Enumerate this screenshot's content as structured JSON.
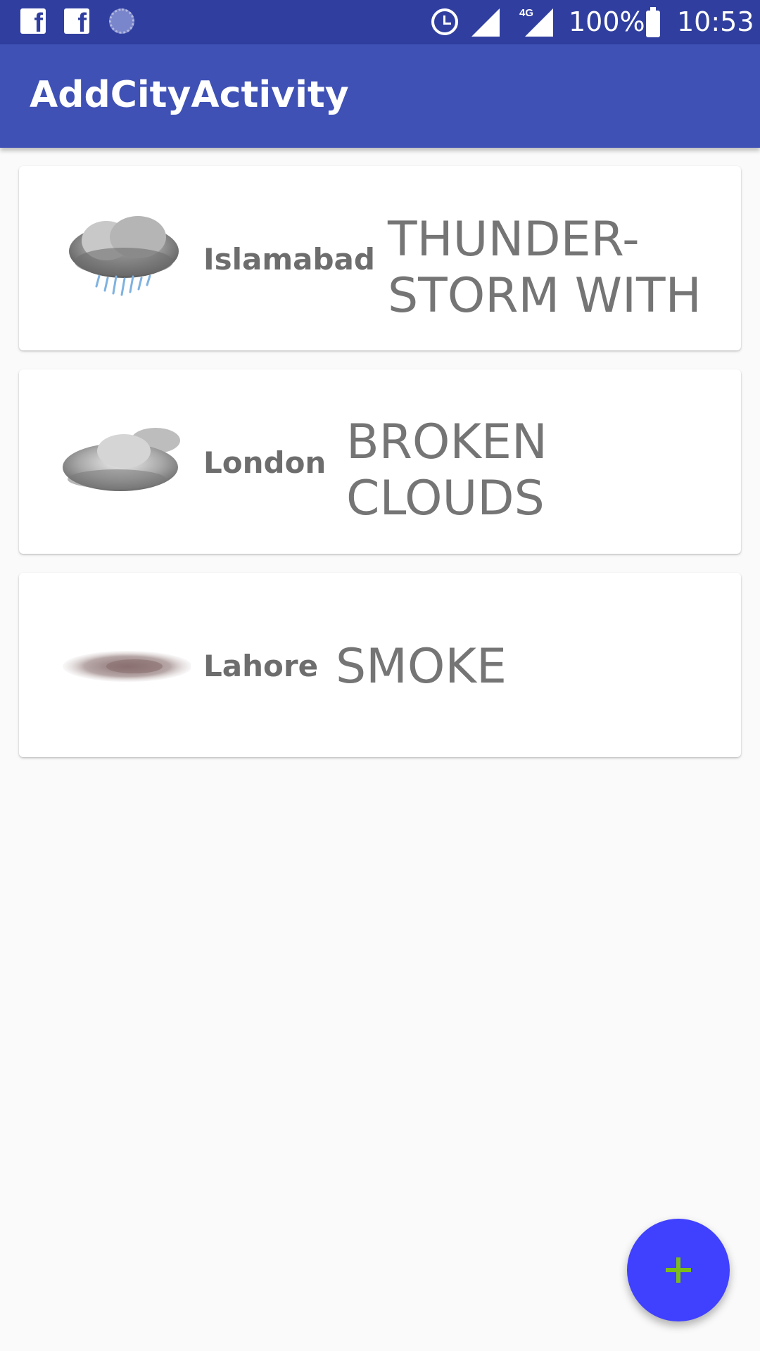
{
  "status_bar": {
    "battery": "100%",
    "time": "10:53",
    "network": "4G",
    "icons": [
      "facebook-icon",
      "facebook-icon",
      "sync-icon",
      "alarm-icon",
      "signal-icon",
      "signal-icon",
      "battery-charging-icon"
    ]
  },
  "app_bar": {
    "title": "AddCityActivity",
    "color": "#3f51b5",
    "status_color": "#303f9f"
  },
  "cities": [
    {
      "name": "Islamabad",
      "condition": "THUNDER-\nSTORM WITH",
      "icon": "thunderstorm-rain-icon"
    },
    {
      "name": "London",
      "condition": "BROKEN\nCLOUDS",
      "icon": "broken-clouds-icon"
    },
    {
      "name": "Lahore",
      "condition": "SMOKE",
      "icon": "smoke-icon"
    }
  ],
  "fab": {
    "icon": "plus-icon",
    "background": "#4040ff",
    "icon_color": "#7cbc1a"
  }
}
